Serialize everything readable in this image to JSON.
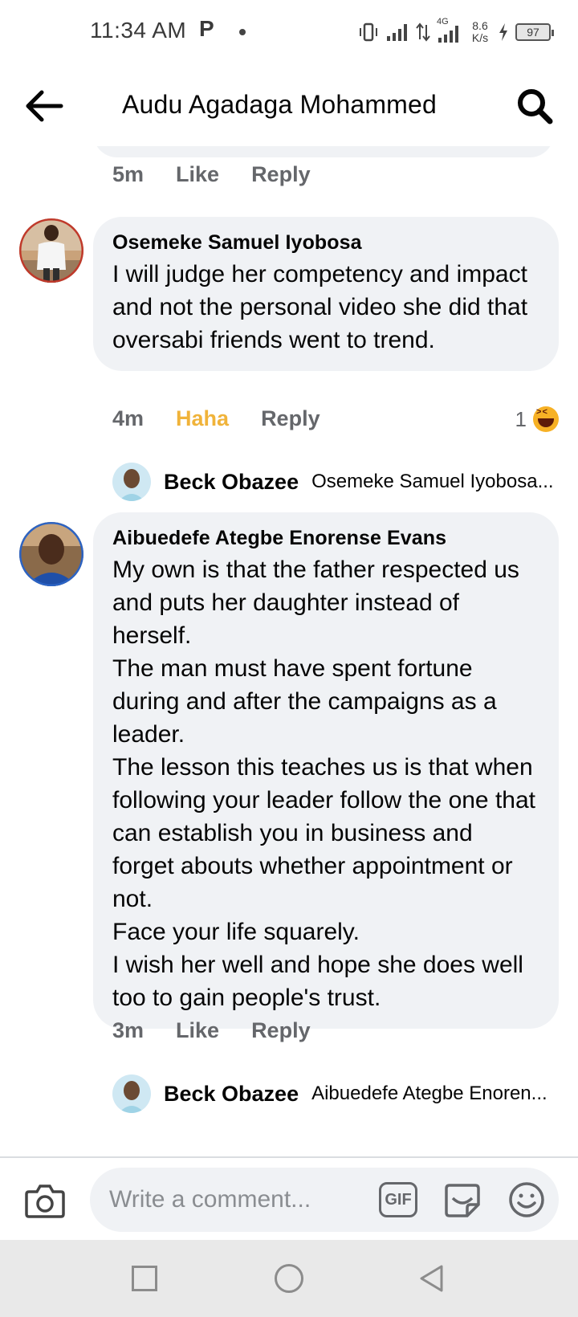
{
  "status_bar": {
    "time": "11:34 AM",
    "app_indicator": "P",
    "net_speed_value": "8.6",
    "net_speed_unit": "K/s",
    "network_type": "4G",
    "battery": "97"
  },
  "header": {
    "title": "Audu Agadaga Mohammed",
    "back_icon": "arrow-left-icon",
    "search_icon": "search-icon"
  },
  "previous_comment": {
    "time": "5m",
    "like_label": "Like",
    "reply_label": "Reply"
  },
  "comments": [
    {
      "author": "Osemeke Samuel Iyobosa",
      "text": "I will judge her competency and impact and not the personal video she did that oversabi friends went to trend.",
      "time": "4m",
      "reaction_label": "Haha",
      "reply_label": "Reply",
      "reaction_count": "1",
      "reaction_icon": "haha-emoji-icon",
      "reply_preview": {
        "name": "Beck Obazee",
        "snippet": "Osemeke Samuel Iyobosa..."
      }
    },
    {
      "author": "Aibuedefe Ategbe Enorense Evans",
      "text": "My own is that the father respected us and puts her daughter instead of herself.\nThe man must have spent fortune during and after the campaigns as a leader.\nThe lesson this teaches us is that when following your leader follow the one that can establish you in business and forget abouts whether appointment or not.\nFace your life squarely.\nI wish her well and hope she does well too to gain people's trust.",
      "time": "3m",
      "like_label": "Like",
      "reply_label": "Reply",
      "reply_preview": {
        "name": "Beck Obazee",
        "snippet": "Aibuedefe Ategbe Enoren..."
      }
    }
  ],
  "composer": {
    "placeholder": "Write a comment...",
    "gif_label": "GIF",
    "camera_icon": "camera-icon",
    "sticker_icon": "sticker-icon",
    "emoji_icon": "smiley-icon"
  },
  "colors": {
    "bubble": "#f0f2f5",
    "meta_text": "#65676b",
    "haha": "#f0b33a"
  }
}
